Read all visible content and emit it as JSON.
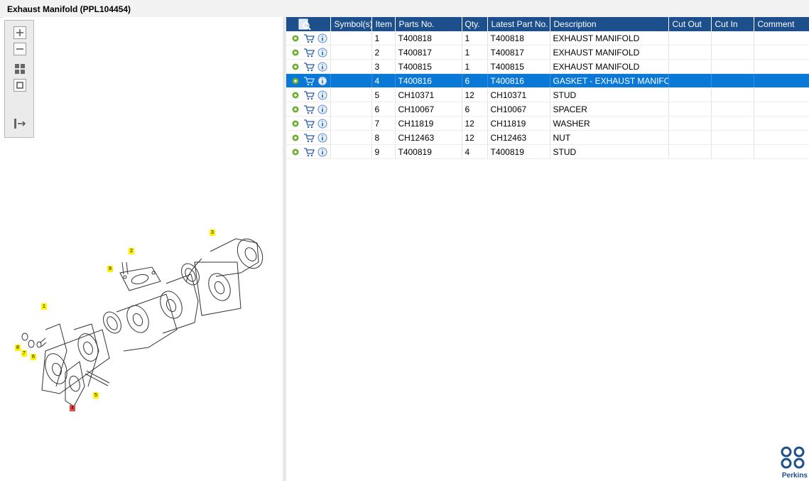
{
  "window": {
    "title": "Exhaust Manifold (PPL104454)"
  },
  "toolbar": {
    "zoom_in": "zoom-in",
    "zoom_out": "zoom-out",
    "fit_all": "fit-all",
    "fit_one": "fit-one",
    "export": "export"
  },
  "table": {
    "headers": [
      "",
      "Symbol(s)",
      "Item",
      "Parts No.",
      "Qty.",
      "Latest Part No.",
      "Description",
      "Cut Out",
      "Cut In",
      "Comment"
    ],
    "rows": [
      {
        "item": "1",
        "part": "T400818",
        "qty": "1",
        "latest": "T400818",
        "desc": "EXHAUST MANIFOLD"
      },
      {
        "item": "2",
        "part": "T400817",
        "qty": "1",
        "latest": "T400817",
        "desc": "EXHAUST MANIFOLD"
      },
      {
        "item": "3",
        "part": "T400815",
        "qty": "1",
        "latest": "T400815",
        "desc": "EXHAUST MANIFOLD"
      },
      {
        "item": "4",
        "part": "T400816",
        "qty": "6",
        "latest": "T400816",
        "desc": "GASKET - EXHAUST MANIFOLD"
      },
      {
        "item": "5",
        "part": "CH10371",
        "qty": "12",
        "latest": "CH10371",
        "desc": "STUD"
      },
      {
        "item": "6",
        "part": "CH10067",
        "qty": "6",
        "latest": "CH10067",
        "desc": "SPACER"
      },
      {
        "item": "7",
        "part": "CH11819",
        "qty": "12",
        "latest": "CH11819",
        "desc": "WASHER"
      },
      {
        "item": "8",
        "part": "CH12463",
        "qty": "12",
        "latest": "CH12463",
        "desc": "NUT"
      },
      {
        "item": "9",
        "part": "T400819",
        "qty": "4",
        "latest": "T400819",
        "desc": "STUD"
      }
    ],
    "selected_item": "4"
  },
  "drawing": {
    "callouts": [
      "1",
      "2",
      "3",
      "4",
      "5",
      "6",
      "7",
      "8",
      "9"
    ]
  },
  "branding": {
    "logo_text": "Perkins"
  },
  "colors": {
    "header": "#1d4f8d",
    "selected": "#0a78d7",
    "callout": "#fff200",
    "callout_selected": "#e34b4b"
  }
}
